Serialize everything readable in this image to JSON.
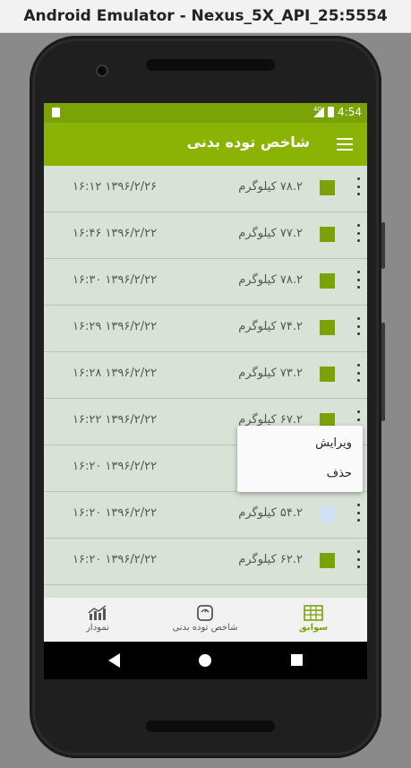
{
  "window": {
    "title": "Android Emulator - Nexus_5X_API_25:5554"
  },
  "statusbar": {
    "network": "4G",
    "time": "4:54"
  },
  "appbar": {
    "title": "شاخص توده بدنی"
  },
  "records": [
    {
      "weight": "۷۸.۲ کیلوگرم",
      "date": "۱۳۹۶/۲/۲۶  ۱۶:۱۲",
      "color": "#7aa307"
    },
    {
      "weight": "۷۷.۲ کیلوگرم",
      "date": "۱۳۹۶/۲/۲۲  ۱۶:۴۶",
      "color": "#7aa307"
    },
    {
      "weight": "۷۸.۲ کیلوگرم",
      "date": "۱۳۹۶/۲/۲۲  ۱۶:۳۰",
      "color": "#7aa307"
    },
    {
      "weight": "۷۴.۲ کیلوگرم",
      "date": "۱۳۹۶/۲/۲۲  ۱۶:۲۹",
      "color": "#7aa307"
    },
    {
      "weight": "۷۳.۲ کیلوگرم",
      "date": "۱۳۹۶/۲/۲۲  ۱۶:۲۸",
      "color": "#7aa307"
    },
    {
      "weight": "۶۷.۲ کیلوگرم",
      "date": "۱۳۹۶/۲/۲۲  ۱۶:۲۲",
      "color": "#7aa307"
    },
    {
      "weight": "",
      "date": "۱۳۹۶/۲/۲۲  ۱۶:۲۰",
      "color": "#7aa307"
    },
    {
      "weight": "۵۴.۲ کیلوگرم",
      "date": "۱۳۹۶/۲/۲۲  ۱۶:۲۰",
      "color": "#cfe0f5"
    },
    {
      "weight": "۶۲.۲ کیلوگرم",
      "date": "۱۳۹۶/۲/۲۲  ۱۶:۲۰",
      "color": "#7aa307"
    }
  ],
  "popup_menu": {
    "edit": "ویرایش",
    "delete": "حذف"
  },
  "bottom_nav": {
    "chart": {
      "label": "نمودار",
      "icon": "chart-icon"
    },
    "bmi": {
      "label": "شاخص توده بدنی",
      "icon": "scale-icon"
    },
    "history": {
      "label": "سوابق",
      "icon": "table-icon"
    }
  },
  "colors": {
    "accent": "#8bb306",
    "status": "#7aa307",
    "list_bg": "#d8e3d6"
  }
}
